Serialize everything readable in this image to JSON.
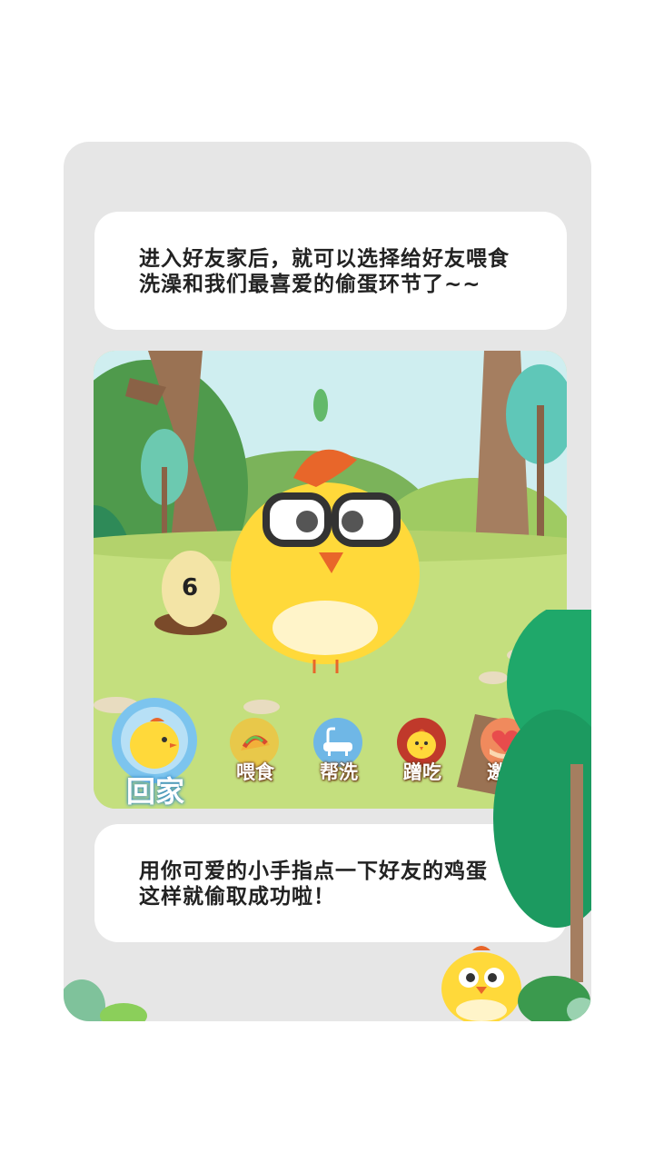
{
  "screen": {
    "card_background": "#e6e6e6",
    "top_caption": "进入好友家后，就可以选择给好友喂食\n洗澡和我们最喜爱的偷蛋环节了~~",
    "bottom_caption": "用你可爱的小手指点一下好友的鸡蛋\n这样就偷取成功啦！"
  },
  "game": {
    "egg_count": "6",
    "actions": [
      {
        "label": "回家",
        "icon": "chick-home-icon"
      },
      {
        "label": "喂食",
        "icon": "taco-food-icon"
      },
      {
        "label": "帮洗",
        "icon": "bathtub-icon"
      },
      {
        "label": "蹭吃",
        "icon": "small-chick-icon"
      },
      {
        "label": "邀请",
        "icon": "heart-hand-icon"
      }
    ],
    "colors": {
      "grass": "#c4df7e",
      "chick_yellow": "#ffd93a",
      "comb_orange": "#e8662a",
      "home_ring": "#7cc4ee"
    }
  }
}
